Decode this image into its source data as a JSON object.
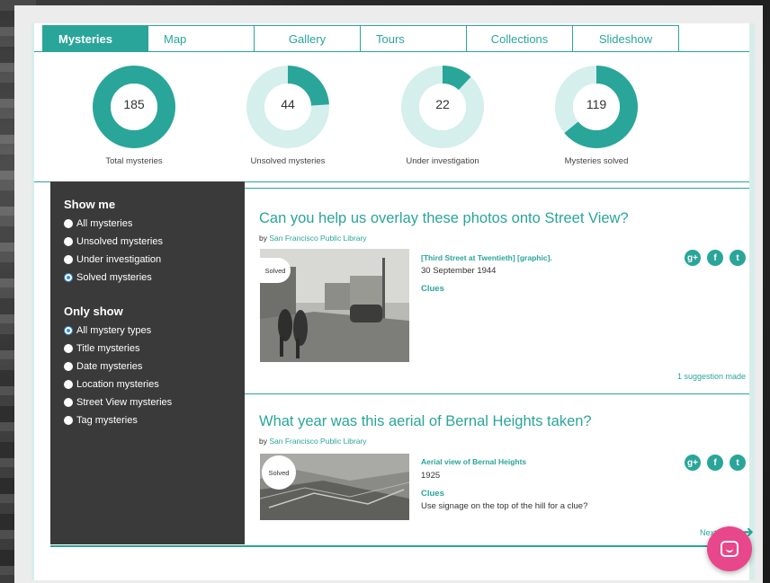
{
  "tabs": [
    {
      "label": "Mysteries",
      "active": true
    },
    {
      "label": "Map",
      "active": false
    },
    {
      "label": "Gallery",
      "active": false
    },
    {
      "label": "Tours",
      "active": false
    },
    {
      "label": "Collections",
      "active": false
    },
    {
      "label": "Slideshow",
      "active": false
    }
  ],
  "stats": [
    {
      "value": "185",
      "label": "Total mysteries",
      "fraction": 1.0
    },
    {
      "value": "44",
      "label": "Unsolved mysteries",
      "fraction": 0.24
    },
    {
      "value": "22",
      "label": "Under investigation",
      "fraction": 0.12
    },
    {
      "value": "119",
      "label": "Mysteries solved",
      "fraction": 0.64
    }
  ],
  "colors": {
    "accent": "#2aa59a",
    "accent_light": "#d4efec",
    "sidebar": "#3a3a3a",
    "chat": "#e8478b"
  },
  "sidebar": {
    "show_me_heading": "Show me",
    "show_me": [
      {
        "label": "All mysteries",
        "selected": false
      },
      {
        "label": "Unsolved mysteries",
        "selected": false
      },
      {
        "label": "Under investigation",
        "selected": false
      },
      {
        "label": "Solved mysteries",
        "selected": true
      }
    ],
    "only_show_heading": "Only show",
    "only_show": [
      {
        "label": "All mystery types",
        "selected": true
      },
      {
        "label": "Title mysteries",
        "selected": false
      },
      {
        "label": "Date mysteries",
        "selected": false
      },
      {
        "label": "Location mysteries",
        "selected": false
      },
      {
        "label": "Street View mysteries",
        "selected": false
      },
      {
        "label": "Tag mysteries",
        "selected": false
      }
    ]
  },
  "mysteries": [
    {
      "title": "Can you help us overlay these photos onto Street View?",
      "by_prefix": "by",
      "by": "San Francisco Public Library",
      "badge": "Solved",
      "record_title": "[Third Street at Twentieth] [graphic].",
      "record_date": "30 September 1944",
      "clues_label": "Clues",
      "hint": "",
      "suggestions": "1 suggestion made"
    },
    {
      "title": "What year was this aerial of Bernal Heights taken?",
      "by_prefix": "by",
      "by": "San Francisco Public Library",
      "badge": "Solved",
      "record_title": "Aerial view of Bernal Heights",
      "record_date": "1925",
      "clues_label": "Clues",
      "hint": "Use signage on the top of the hill for a clue?",
      "suggestions": ""
    }
  ],
  "social_icons": [
    "google-plus-icon",
    "facebook-icon",
    "twitter-icon"
  ],
  "next_label": "Next"
}
